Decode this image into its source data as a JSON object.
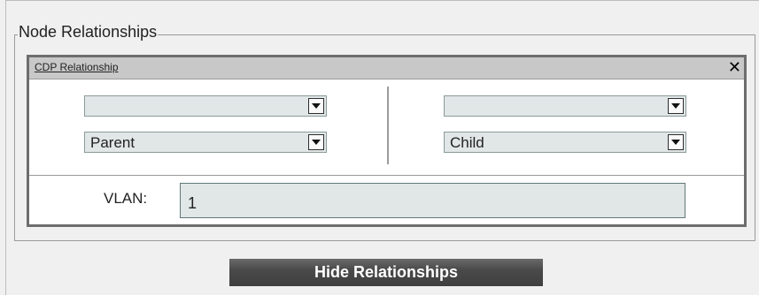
{
  "fieldset": {
    "legend": "Node Relationships"
  },
  "relationship_panel": {
    "title": "CDP Relationship",
    "close_icon": "close-x-icon",
    "close_label": "✕",
    "left": {
      "node_select_value": "",
      "role_select_value": "Parent"
    },
    "right": {
      "node_select_value": "",
      "role_select_value": "Child"
    },
    "vlan": {
      "label": "VLAN:",
      "value": "1"
    }
  },
  "actions": {
    "hide_relationships_label": "Hide Relationships"
  }
}
